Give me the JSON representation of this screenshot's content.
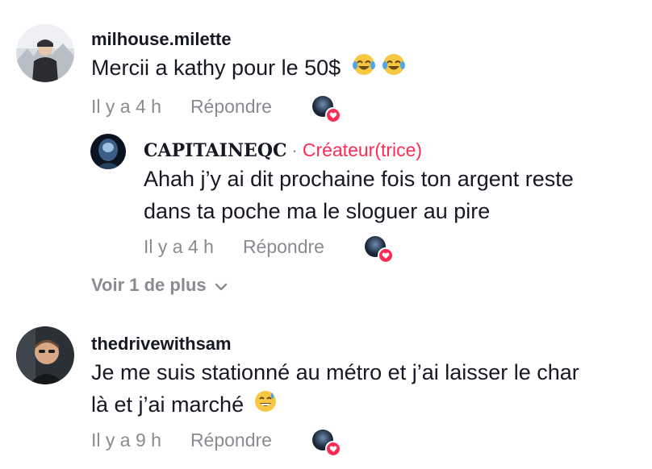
{
  "comments": [
    {
      "username": "milhouse.milette",
      "text": "Mercii a kathy pour le 50$",
      "emoji": [
        "laughing-tears-emoji",
        "laughing-tears-emoji"
      ],
      "time": "Il y a 4 h",
      "reply_label": "Répondre",
      "liked_by_creator": true
    },
    {
      "username": "CAPITAINEQC",
      "creator_separator": "·",
      "creator_label": "Créateur(trice)",
      "text_lines": [
        "Ahah j’y ai dit prochaine fois ton argent reste",
        "dans ta poche ma le sloguer au pire"
      ],
      "time": "Il y a 4 h",
      "reply_label": "Répondre",
      "liked_by_creator": true
    },
    {
      "username": "thedrivewithsam",
      "text_lines": [
        "Je me suis stationné au métro et j’ai laisser le char",
        "là et j’ai marché"
      ],
      "emoji": [
        "grinning-sweat-emoji"
      ],
      "time": "Il y a 9 h",
      "reply_label": "Répondre",
      "liked_by_creator": true
    }
  ],
  "view_more": {
    "label": "Voir 1 de plus",
    "icon": "chevron-down-icon"
  },
  "colors": {
    "text_primary": "#161823",
    "text_secondary": "#8a8b91",
    "accent": "#fe2c55"
  }
}
